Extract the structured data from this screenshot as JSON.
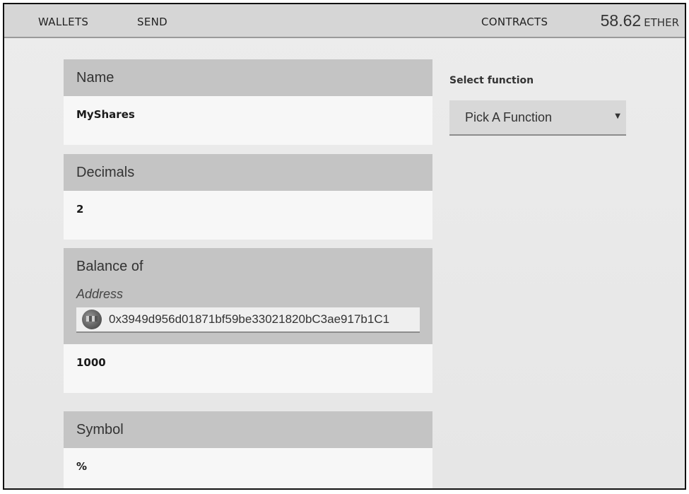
{
  "nav": {
    "wallets": "WALLETS",
    "send": "SEND",
    "contracts": "CONTRACTS"
  },
  "balance": {
    "amount": "58.62",
    "unit": "ETHER"
  },
  "panels": {
    "name": {
      "title": "Name",
      "value": "MyShares"
    },
    "decimals": {
      "title": "Decimals",
      "value": "2"
    },
    "balance_of": {
      "title": "Balance of",
      "arg_label": "Address",
      "address": "0x3949d956d01871bf59be33021820bC3ae917b1C1",
      "value": "1000"
    },
    "symbol": {
      "title": "Symbol",
      "value": "%"
    }
  },
  "functions": {
    "label": "Select function",
    "selected": "Pick A Function",
    "caret_icon": "caret-down-icon"
  },
  "colors": {
    "topbar": "#d6d6d6",
    "panel_head": "#c4c4c4",
    "panel_body": "#f7f7f7",
    "background": "#e8e8e8"
  }
}
